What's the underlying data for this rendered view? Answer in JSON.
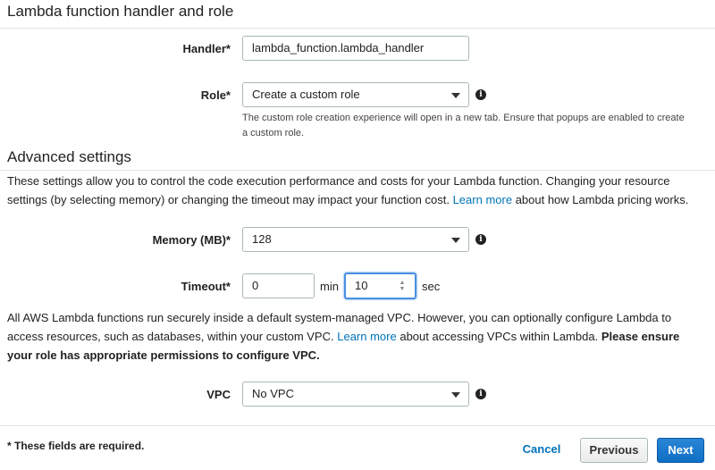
{
  "handler_section": {
    "title": "Lambda function handler and role",
    "handler_label": "Handler*",
    "handler_value": "lambda_function.lambda_handler",
    "role_label": "Role*",
    "role_value": "Create a custom role",
    "role_help": "The custom role creation experience will open in a new tab. Ensure that popups are enabled to create a custom role."
  },
  "advanced_section": {
    "title": "Advanced settings",
    "intro_before_link": "These settings allow you to control the code execution performance and costs for your Lambda function. Changing your resource settings (by selecting memory) or changing the timeout may impact your function cost.",
    "intro_link": "Learn more",
    "intro_after_link": "about how Lambda pricing works.",
    "memory_label": "Memory (MB)*",
    "memory_value": "128",
    "timeout_label": "Timeout*",
    "timeout_min_value": "0",
    "timeout_min_unit": "min",
    "timeout_sec_value": "10",
    "timeout_sec_unit": "sec",
    "vpc_intro_before_link": "All AWS Lambda functions run securely inside a default system-managed VPC. However, you can optionally configure Lambda to access resources, such as databases, within your custom VPC.",
    "vpc_intro_link": "Learn more",
    "vpc_intro_after_link": "about accessing VPCs within Lambda.",
    "vpc_intro_bold": "Please ensure your role has appropriate permissions to configure VPC.",
    "vpc_label": "VPC",
    "vpc_value": "No VPC"
  },
  "footer": {
    "required_note": "* These fields are required.",
    "cancel_label": "Cancel",
    "previous_label": "Previous",
    "next_label": "Next"
  },
  "icons": {
    "info": "info-icon",
    "dropdown": "chevron-down-icon",
    "spinner": "stepper-icon"
  },
  "colors": {
    "link": "#0073bb",
    "primary_button": "#0f6fc6",
    "focus_ring": "#4a90e2"
  }
}
